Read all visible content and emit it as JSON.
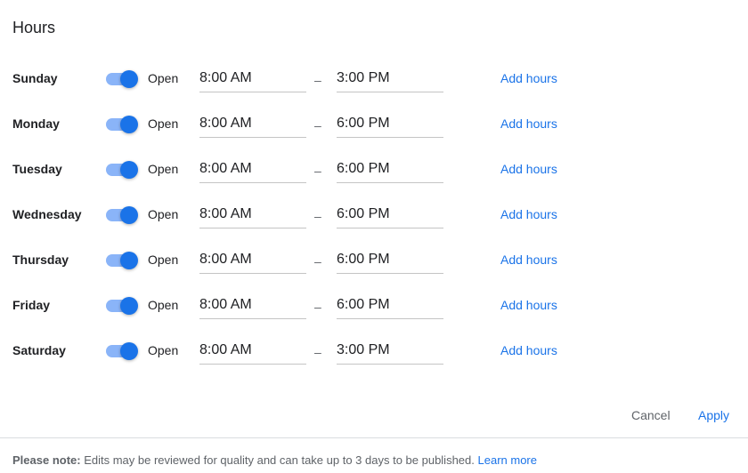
{
  "title": "Hours",
  "days": [
    {
      "day": "Sunday",
      "state": "Open",
      "open": "8:00 AM",
      "close": "3:00 PM",
      "toggle_on": true
    },
    {
      "day": "Monday",
      "state": "Open",
      "open": "8:00 AM",
      "close": "6:00 PM",
      "toggle_on": true
    },
    {
      "day": "Tuesday",
      "state": "Open",
      "open": "8:00 AM",
      "close": "6:00 PM",
      "toggle_on": true
    },
    {
      "day": "Wednesday",
      "state": "Open",
      "open": "8:00 AM",
      "close": "6:00 PM",
      "toggle_on": true
    },
    {
      "day": "Thursday",
      "state": "Open",
      "open": "8:00 AM",
      "close": "6:00 PM",
      "toggle_on": true
    },
    {
      "day": "Friday",
      "state": "Open",
      "open": "8:00 AM",
      "close": "6:00 PM",
      "toggle_on": true
    },
    {
      "day": "Saturday",
      "state": "Open",
      "open": "8:00 AM",
      "close": "3:00 PM",
      "toggle_on": true
    }
  ],
  "range_separator": "–",
  "add_hours_label": "Add hours",
  "actions": {
    "cancel_label": "Cancel",
    "apply_label": "Apply"
  },
  "note": {
    "prefix": "Please note:",
    "text": "Edits may be reviewed for quality and can take up to 3 days to be published.",
    "link": "Learn more"
  },
  "colors": {
    "accent": "#1a73e8",
    "toggle_track": "#8ab4f8",
    "text": "#202124",
    "muted": "#5f6368"
  }
}
